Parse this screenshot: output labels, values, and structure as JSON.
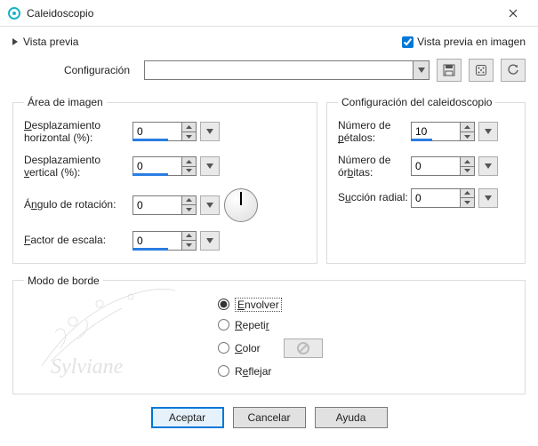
{
  "window": {
    "title": "Caleidoscopio"
  },
  "topbar": {
    "vista_previa": "Vista previa",
    "vista_previa_imagen": "Vista previa en imagen"
  },
  "config": {
    "label": "Configuración",
    "value": ""
  },
  "area_group": {
    "legend": "Área de imagen",
    "desp_h_label": "Desplazamiento horizontal (%):",
    "desp_h_value": "0",
    "desp_v_label": "Desplazamiento vertical (%):",
    "desp_v_value": "0",
    "angulo_label": "Ángulo de rotación:",
    "angulo_value": "0",
    "factor_label": "Factor de escala:",
    "factor_value": "0"
  },
  "caleido_group": {
    "legend": "Configuración del caleidoscopio",
    "petalos_label_1": "Número de",
    "petalos_label_2": "pétalos:",
    "petalos_value": "10",
    "orbitas_label_1": "Número de",
    "orbitas_label_2": "órbitas:",
    "orbitas_value": "0",
    "succion_label_1": "Succión",
    "succion_label_2": "radial:",
    "succion_value": "0"
  },
  "border_mode": {
    "legend": "Modo de borde",
    "envolver": "Envolver",
    "repetir": "Repetir",
    "color": "Color",
    "reflejar": "Reflejar"
  },
  "buttons": {
    "aceptar": "Aceptar",
    "cancelar": "Cancelar",
    "ayuda": "Ayuda"
  }
}
